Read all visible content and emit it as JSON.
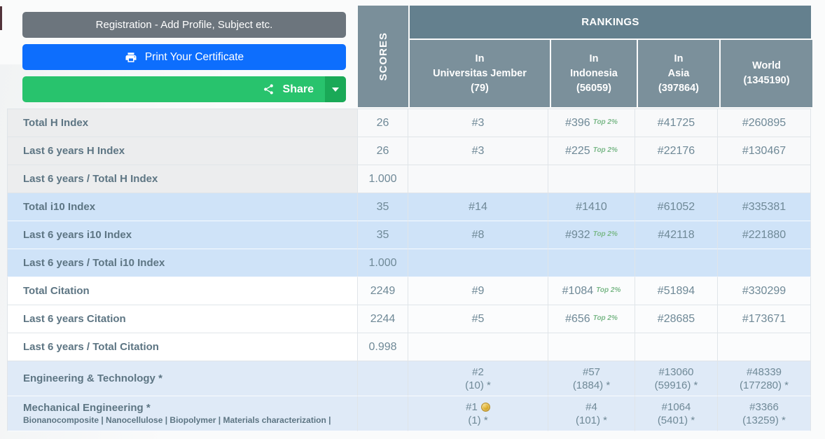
{
  "buttons": {
    "registration_label": "Registration - Add Profile, Subject etc.",
    "print_label": "Print Your Certificate",
    "share_label": "Share"
  },
  "icons": {
    "print": "printer",
    "share": "share-nodes",
    "share_toggle": "caret-down",
    "first_rank": "gold-medal"
  },
  "colors": {
    "button_gray": "#6c757d",
    "button_blue": "#0d6efd",
    "button_green": "#28c36d",
    "button_green_dark": "#1aa957",
    "rankings_bar": "#64808e",
    "column_header": "#7b909b",
    "row_blue": "#cfe3f8",
    "row_blue_light": "#dfeaf7",
    "top2_badge": "#7cb98a"
  },
  "table": {
    "scores_header": "SCORES",
    "rankings_header": "RANKINGS",
    "columns": [
      {
        "line1": "In",
        "line2": "Universitas Jember",
        "line3": "(79)"
      },
      {
        "line1": "In",
        "line2": "Indonesia",
        "line3": "(56059)"
      },
      {
        "line1": "In",
        "line2": "Asia",
        "line3": "(397864)"
      },
      {
        "line1": "World",
        "line2": "(1345190)"
      }
    ],
    "rows": [
      {
        "label": "Total H Index",
        "score": "26",
        "ranks": [
          {
            "v": "#3"
          },
          {
            "v": "#396",
            "tag": "Top 2%"
          },
          {
            "v": "#41725"
          },
          {
            "v": "#260895"
          }
        ]
      },
      {
        "label": "Last 6 years H Index",
        "score": "26",
        "ranks": [
          {
            "v": "#3"
          },
          {
            "v": "#225",
            "tag": "Top 2%"
          },
          {
            "v": "#22176"
          },
          {
            "v": "#130467"
          }
        ]
      },
      {
        "label": "Last 6 years / Total H Index",
        "score": "1.000",
        "ranks": [
          {},
          {},
          {},
          {}
        ]
      },
      {
        "label": "Total i10 Index",
        "score": "35",
        "ranks": [
          {
            "v": "#14"
          },
          {
            "v": "#1410"
          },
          {
            "v": "#61052"
          },
          {
            "v": "#335381"
          }
        ]
      },
      {
        "label": "Last 6 years i10 Index",
        "score": "35",
        "ranks": [
          {
            "v": "#8"
          },
          {
            "v": "#932",
            "tag": "Top 2%"
          },
          {
            "v": "#42118"
          },
          {
            "v": "#221880"
          }
        ]
      },
      {
        "label": "Last 6 years / Total i10 Index",
        "score": "1.000",
        "ranks": [
          {},
          {},
          {},
          {}
        ]
      },
      {
        "label": "Total Citation",
        "score": "2249",
        "ranks": [
          {
            "v": "#9"
          },
          {
            "v": "#1084",
            "tag": "Top 2%"
          },
          {
            "v": "#51894"
          },
          {
            "v": "#330299"
          }
        ]
      },
      {
        "label": "Last 6 years Citation",
        "score": "2244",
        "ranks": [
          {
            "v": "#5"
          },
          {
            "v": "#656",
            "tag": "Top 2%"
          },
          {
            "v": "#28685"
          },
          {
            "v": "#173671"
          }
        ]
      },
      {
        "label": "Last 6 years / Total Citation",
        "score": "0.998",
        "ranks": [
          {},
          {},
          {},
          {}
        ]
      },
      {
        "label": "Engineering & Technology *",
        "score": "",
        "ranks": [
          {
            "v": "#2",
            "sub": "(10) *"
          },
          {
            "v": "#57",
            "sub": "(1884) *"
          },
          {
            "v": "#13060",
            "sub": "(59916) *"
          },
          {
            "v": "#48339",
            "sub": "(177280) *"
          }
        ]
      },
      {
        "label": "Mechanical Engineering *",
        "sublabel": "Bionanocomposite | Nanocellulose | Biopolymer | Materials characterization |",
        "score": "",
        "ranks": [
          {
            "v": "#1",
            "sub": "(1) *"
          },
          {
            "v": "#4",
            "sub": "(101) *"
          },
          {
            "v": "#1064",
            "sub": "(5401) *"
          },
          {
            "v": "#3366",
            "sub": "(13259) *"
          }
        ]
      }
    ]
  }
}
